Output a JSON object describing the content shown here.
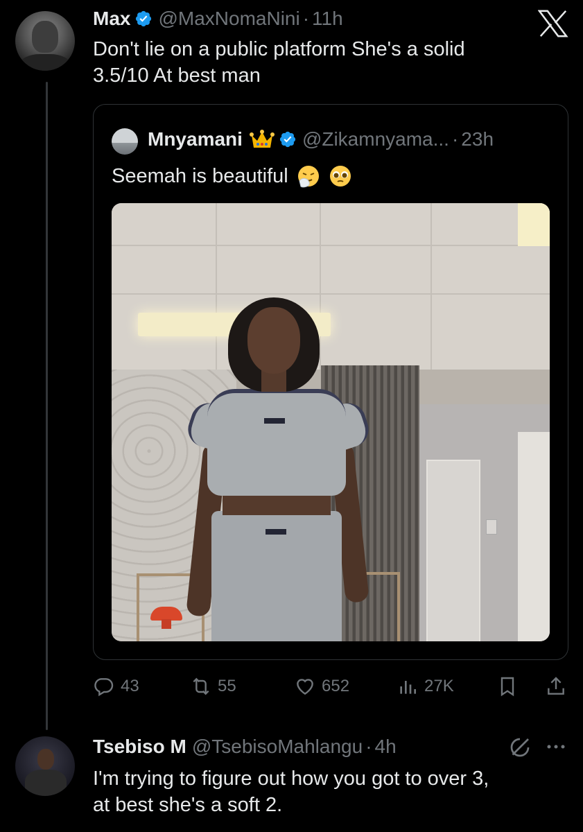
{
  "app": {
    "logo": "x-logo"
  },
  "tweet1": {
    "author_name": "Max",
    "author_handle": "@MaxNomaNini",
    "separator": "·",
    "time": "11h",
    "text": "Don't lie on a public platform She's a solid\n3.5/10 At best man",
    "verified": true,
    "quote": {
      "author_name": "Mnyamani",
      "author_handle": "@Zikamnyama...",
      "separator": "·",
      "time": "23h",
      "text": "Seemah is beautiful",
      "badges": [
        "crown-emoji",
        "verified-icon"
      ],
      "text_emojis": [
        "sneezing-face-emoji",
        "pleading-face-emoji"
      ],
      "media": "photo of woman in grey crop top and skirt standing in a room"
    },
    "actions": {
      "replies": "43",
      "reposts": "55",
      "likes": "652",
      "views": "27K"
    }
  },
  "tweet2": {
    "author_name": "Tsebiso M",
    "author_handle": "@TsebisoMahlangu",
    "separator": "·",
    "time": "4h",
    "text": "I'm trying to figure out how you got to over 3,\nat best she's a soft 2."
  },
  "colors": {
    "background": "#000000",
    "text": "#e7e9ea",
    "muted": "#71767b",
    "verified": "#1d9bf0",
    "border": "#2f3336"
  }
}
